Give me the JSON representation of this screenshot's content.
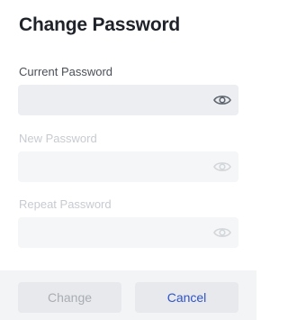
{
  "dialog": {
    "title": "Change Password",
    "fields": [
      {
        "label": "Current Password",
        "value": "",
        "placeholder": "",
        "disabled": false
      },
      {
        "label": "New Password",
        "value": "",
        "placeholder": "",
        "disabled": true
      },
      {
        "label": "Repeat Password",
        "value": "",
        "placeholder": "",
        "disabled": true
      }
    ],
    "buttons": {
      "change_label": "Change",
      "cancel_label": "Cancel"
    }
  },
  "colors": {
    "accent": "#2f54c7",
    "title": "#1f2329",
    "field_bg": "#eceef1",
    "footer_bg": "#f3f4f6"
  },
  "icons": {
    "visibility": "eye-icon"
  }
}
